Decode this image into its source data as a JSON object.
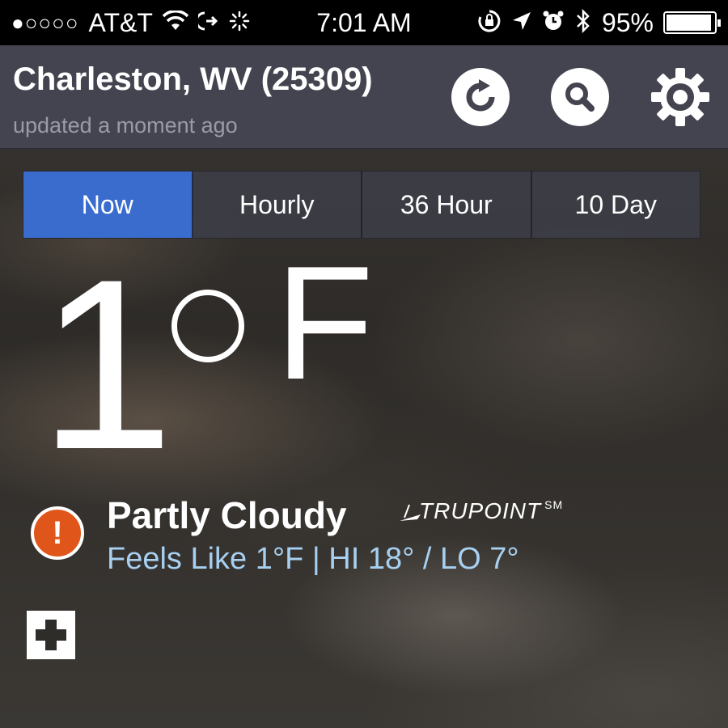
{
  "status_bar": {
    "signal": "●○○○○",
    "carrier": "AT&T",
    "time": "7:01 AM",
    "battery": "95%",
    "battery_level": 0.95,
    "icons": [
      "wifi-icon",
      "call-forward-icon",
      "activity-spinner-icon",
      "orientation-lock-icon",
      "location-arrow-icon",
      "alarm-icon",
      "bluetooth-icon"
    ]
  },
  "header": {
    "location": "Charleston, WV (25309)",
    "updated": "updated a moment ago",
    "buttons": [
      "refresh-icon",
      "search-icon",
      "gear-icon"
    ]
  },
  "tabs": [
    {
      "label": "Now",
      "active": true
    },
    {
      "label": "Hourly",
      "active": false
    },
    {
      "label": "36 Hour",
      "active": false
    },
    {
      "label": "10 Day",
      "active": false
    }
  ],
  "current": {
    "temperature": "1",
    "unit": "F",
    "condition": "Partly Cloudy",
    "brand": "TRUPOINT",
    "brand_mark": "SM",
    "feels_like": "Feels Like 1°F | HI 18° / LO 7°"
  },
  "colors": {
    "header_bg": "#43444f",
    "tab_active": "#3a6ccd",
    "alert": "#e0561a",
    "feels_text": "#a7d0f0"
  }
}
